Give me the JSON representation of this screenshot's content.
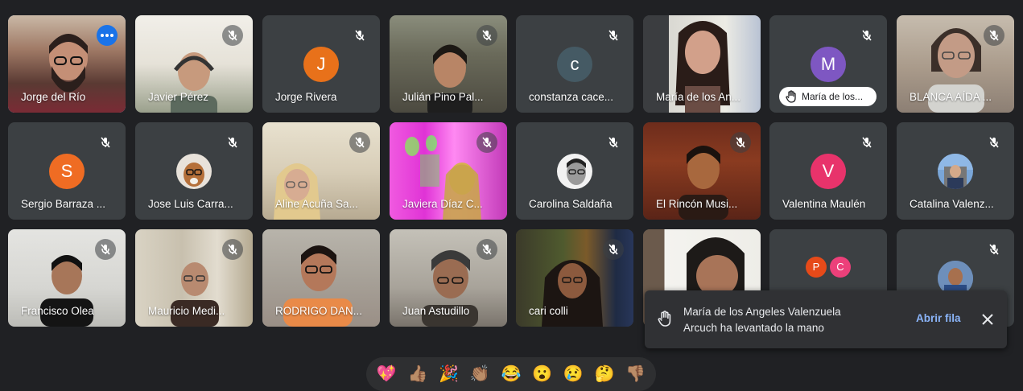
{
  "participants": [
    {
      "name": "Jorge del Río"
    },
    {
      "name": "Javier Pérez"
    },
    {
      "name": "Jorge Rivera",
      "initial": "J",
      "color": "#e8711a"
    },
    {
      "name": "Julián Pino Pal..."
    },
    {
      "name": "constanza cace...",
      "initial": "c",
      "color": "#455a64"
    },
    {
      "name": "María de los An..."
    },
    {
      "name": "María de los...",
      "initial": "M",
      "color": "#7e57c2"
    },
    {
      "name": "BLANCA AÍDA ..."
    },
    {
      "name": "Sergio Barraza ...",
      "initial": "S",
      "color": "#ef6c23"
    },
    {
      "name": "Jose Luis Carra..."
    },
    {
      "name": "Aline Acuña Sa..."
    },
    {
      "name": "Javiera Díaz C..."
    },
    {
      "name": "Carolina Saldaña"
    },
    {
      "name": "El Rincón Musi..."
    },
    {
      "name": "Valentina Maulén",
      "initial": "V",
      "color": "#e8336b"
    },
    {
      "name": "Catalina Valenz..."
    },
    {
      "name": "Francisco Olea"
    },
    {
      "name": "Mauricio Medi..."
    },
    {
      "name": "RODRIGO DAN..."
    },
    {
      "name": "Juan Astudillo"
    },
    {
      "name": "cari colli"
    },
    {
      "name": ""
    },
    {
      "name": "",
      "initials": [
        "P",
        "C"
      ],
      "colors": [
        "#e64a19",
        "#ec407a"
      ]
    },
    {
      "name": ""
    }
  ],
  "notification": {
    "line1": "María de los Angeles Valenzuela",
    "line2": "Arcuch ha levantado la mano",
    "action": "Abrir fila"
  },
  "reactions": [
    "💖",
    "👍🏽",
    "🎉",
    "👏🏽",
    "😂",
    "😮",
    "😢",
    "🤔",
    "👎🏽"
  ],
  "colors": {
    "background": "#202124",
    "tile": "#3c4043",
    "accent": "#8ab4f8"
  }
}
